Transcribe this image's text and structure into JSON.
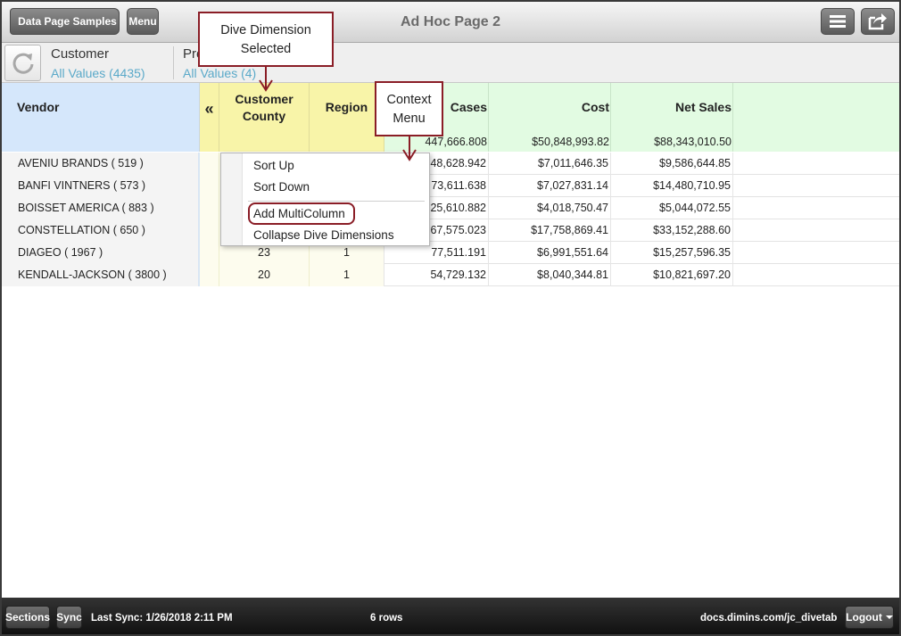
{
  "header": {
    "back_label": "Data Page Samples",
    "menu_label": "Menu",
    "title": "Ad Hoc Page 2",
    "list_icon": "hamburger-icon",
    "share_icon": "share-icon"
  },
  "filters": {
    "reset_icon": "refresh-icon",
    "items": [
      {
        "name": "Customer",
        "value": "All Values (4435)"
      },
      {
        "name": "Pre",
        "value": "All Values (4)"
      }
    ]
  },
  "grid": {
    "columns": {
      "vendor": "Vendor",
      "collapse": "«",
      "county": "Customer County",
      "region": "Region",
      "cases": "Cases",
      "cost": "Cost",
      "net_sales": "Net Sales"
    },
    "totals": {
      "cases": "447,666.808",
      "cost": "$50,848,993.82",
      "net_sales": "$88,343,010.50"
    },
    "rows": [
      {
        "vendor": "AVENIU BRANDS  ( 519 )",
        "county": "",
        "region": "",
        "cases": "48,628.942",
        "cost": "$7,011,646.35",
        "net_sales": "$9,586,644.85"
      },
      {
        "vendor": "BANFI VINTNERS  ( 573 )",
        "county": "",
        "region": "",
        "cases": "73,611.638",
        "cost": "$7,027,831.14",
        "net_sales": "$14,480,710.95"
      },
      {
        "vendor": "BOISSET AMERICA  ( 883 )",
        "county": "",
        "region": "",
        "cases": "25,610.882",
        "cost": "$4,018,750.47",
        "net_sales": "$5,044,072.55"
      },
      {
        "vendor": "CONSTELLATION  ( 650 )",
        "county": "",
        "region": "",
        "cases": "67,575.023",
        "cost": "$17,758,869.41",
        "net_sales": "$33,152,288.60"
      },
      {
        "vendor": "DIAGEO  ( 1967 )",
        "county": "23",
        "region": "1",
        "cases": "77,511.191",
        "cost": "$6,991,551.64",
        "net_sales": "$15,257,596.35"
      },
      {
        "vendor": "KENDALL-JACKSON  ( 3800 )",
        "county": "20",
        "region": "1",
        "cases": "54,729.132",
        "cost": "$8,040,344.81",
        "net_sales": "$10,821,697.20"
      }
    ]
  },
  "context_menu": {
    "items": [
      "Sort Up",
      "Sort Down",
      "Add MultiColumn",
      "Collapse Dive Dimensions"
    ]
  },
  "callouts": {
    "dive": {
      "line1": "Dive Dimension",
      "line2": "Selected"
    },
    "context": {
      "line1": "Context",
      "line2": "Menu"
    }
  },
  "footer": {
    "sections_label": "Sections",
    "sync_label": "Sync",
    "last_sync": "Last Sync: 1/26/2018 2:11 PM",
    "rows_count": "6 rows",
    "url": "docs.dimins.com/jc_divetab",
    "logout_label": "Logout"
  },
  "colors": {
    "accent_callout": "#8a1d26",
    "dimension_header": "#f8f4a8",
    "measure_header": "#e2fbe2",
    "vendor_header": "#d5e7fb",
    "filter_value": "#5aa9c9"
  }
}
